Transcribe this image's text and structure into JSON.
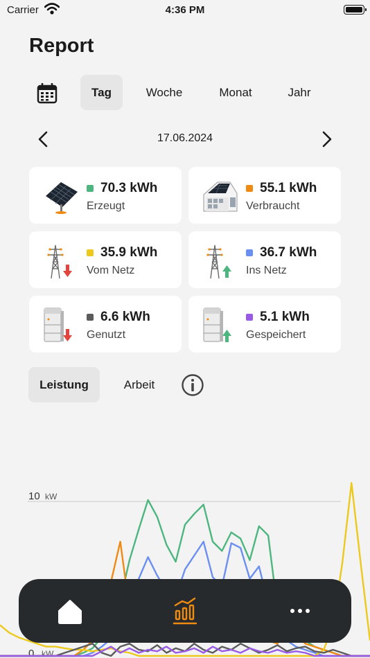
{
  "status_bar": {
    "carrier": "Carrier",
    "time": "4:36 PM"
  },
  "page": {
    "title": "Report"
  },
  "period_tabs": [
    {
      "label": "Tag",
      "active": true
    },
    {
      "label": "Woche",
      "active": false
    },
    {
      "label": "Monat",
      "active": false
    },
    {
      "label": "Jahr",
      "active": false
    }
  ],
  "date_nav": {
    "date": "17.06.2024"
  },
  "summary_cards": [
    {
      "value": "70.3 kWh",
      "label": "Erzeugt",
      "color": "#4db57e",
      "icon": "solar-panel-icon"
    },
    {
      "value": "55.1 kWh",
      "label": "Verbraucht",
      "color": "#ef8a12",
      "icon": "house-icon"
    },
    {
      "value": "35.9 kWh",
      "label": "Vom Netz",
      "color": "#ecc91c",
      "icon": "grid-import-icon"
    },
    {
      "value": "36.7 kWh",
      "label": "Ins Netz",
      "color": "#6b8ff0",
      "icon": "grid-export-icon"
    },
    {
      "value": "6.6 kWh",
      "label": "Genutzt",
      "color": "#5b5b5b",
      "icon": "battery-discharge-icon"
    },
    {
      "value": "5.1 kWh",
      "label": "Gespeichert",
      "color": "#9a5ae6",
      "icon": "battery-charge-icon"
    }
  ],
  "mode_tabs": [
    {
      "label": "Leistung",
      "active": true
    },
    {
      "label": "Arbeit",
      "active": false
    }
  ],
  "chart_data": {
    "type": "line",
    "ylabel_unit": "kW",
    "y_ticks": [
      {
        "value": 10,
        "label": "10",
        "unit": "kW"
      },
      {
        "value": 0,
        "label": "0",
        "unit": "kW"
      }
    ],
    "ylim": [
      0,
      12
    ],
    "x": [
      0,
      0.5,
      1,
      1.5,
      2,
      2.5,
      3,
      3.5,
      4,
      4.5,
      5,
      5.5,
      6,
      6.5,
      7,
      7.5,
      8,
      8.5,
      9,
      9.5,
      10,
      10.5,
      11,
      11.5,
      12,
      12.5,
      13,
      13.5,
      14,
      14.5,
      15,
      15.5,
      16,
      16.5,
      17,
      17.5,
      18,
      18.5,
      19,
      19.5,
      20
    ],
    "grid": true,
    "legend": "none",
    "series": [
      {
        "color": "#4db57e",
        "values": [
          0,
          0,
          0,
          0,
          0,
          0,
          0,
          0,
          0,
          0.2,
          0.5,
          1.2,
          2.2,
          3.6,
          6.2,
          8.2,
          10.1,
          9.0,
          7.2,
          6.1,
          8.5,
          9.2,
          9.8,
          7.4,
          6.8,
          8.0,
          7.6,
          6.2,
          8.4,
          7.8,
          3.0,
          2.0,
          1.8,
          1.0,
          0.6,
          0.4,
          0.2,
          0,
          0,
          0,
          0
        ]
      },
      {
        "color": "#6b8ff0",
        "values": [
          0,
          0,
          0,
          0,
          0,
          0,
          0,
          0,
          0,
          0,
          0.2,
          0.6,
          1.1,
          2.0,
          3.6,
          5.0,
          6.4,
          5.2,
          4.2,
          3.8,
          5.6,
          6.5,
          7.4,
          5.1,
          4.5,
          7.3,
          7.0,
          5.0,
          5.8,
          3.4,
          1.6,
          1.0,
          0.6,
          0.4,
          0.2,
          0,
          0,
          0,
          0,
          0,
          0
        ]
      },
      {
        "color": "#ef8a12",
        "values": [
          0,
          0,
          0,
          0,
          0,
          0,
          0,
          0,
          0,
          0.4,
          1.0,
          2.2,
          4.8,
          7.4,
          3.0,
          1.2,
          3.8,
          4.6,
          3.2,
          1.6,
          3.2,
          4.0,
          2.6,
          2.0,
          3.0,
          2.4,
          1.4,
          2.2,
          1.6,
          1.0,
          0.8,
          2.0,
          1.4,
          0.8,
          0.6,
          0.4,
          0.2,
          0,
          0,
          0,
          0
        ]
      },
      {
        "color": "#ecc91c",
        "values": [
          2.0,
          1.5,
          1.2,
          1.0,
          0.8,
          0.6,
          0.6,
          0.5,
          0.4,
          0.4,
          0.3,
          0.4,
          0.5,
          0.3,
          0.2,
          0,
          0,
          0,
          0,
          0,
          0,
          0,
          0,
          0,
          0,
          0,
          0,
          0,
          0,
          0,
          0,
          0,
          0,
          0,
          0,
          0.4,
          2.0,
          6.0,
          11.2,
          6.0,
          1.0
        ]
      },
      {
        "color": "#5b5b5b",
        "values": [
          0,
          0,
          0,
          0,
          0,
          0,
          0,
          0.2,
          0.4,
          0.6,
          0.8,
          0.2,
          0,
          0.6,
          0.8,
          0.4,
          0.3,
          0.7,
          0.2,
          0.5,
          0.3,
          0.8,
          0.4,
          0.2,
          0.6,
          0.4,
          0.8,
          0.5,
          0.2,
          0.4,
          0.7,
          0.3,
          0.5,
          0.6,
          0.3,
          0.2,
          0.4,
          0.2,
          0,
          0,
          0
        ]
      },
      {
        "color": "#9a5ae6",
        "values": [
          0,
          0,
          0,
          0,
          0,
          0,
          0,
          0,
          0,
          0,
          0,
          0.3,
          0.6,
          0.2,
          0.5,
          0.2,
          0.4,
          0.3,
          0.6,
          0.2,
          0.3,
          0.5,
          0.2,
          0.6,
          0.3,
          0.4,
          0.2,
          0.5,
          0.3,
          0.2,
          0.4,
          0.2,
          0.3,
          0.2,
          0,
          0,
          0,
          0,
          0,
          0,
          0
        ]
      }
    ]
  },
  "bottom_nav": [
    {
      "icon": "home-icon",
      "active": false
    },
    {
      "icon": "chart-icon",
      "active": true
    },
    {
      "icon": "more-icon",
      "active": false
    }
  ],
  "colors": {
    "accent": "#ef8a12",
    "tabbar": "#262a2d",
    "background": "#f3f3f3"
  }
}
